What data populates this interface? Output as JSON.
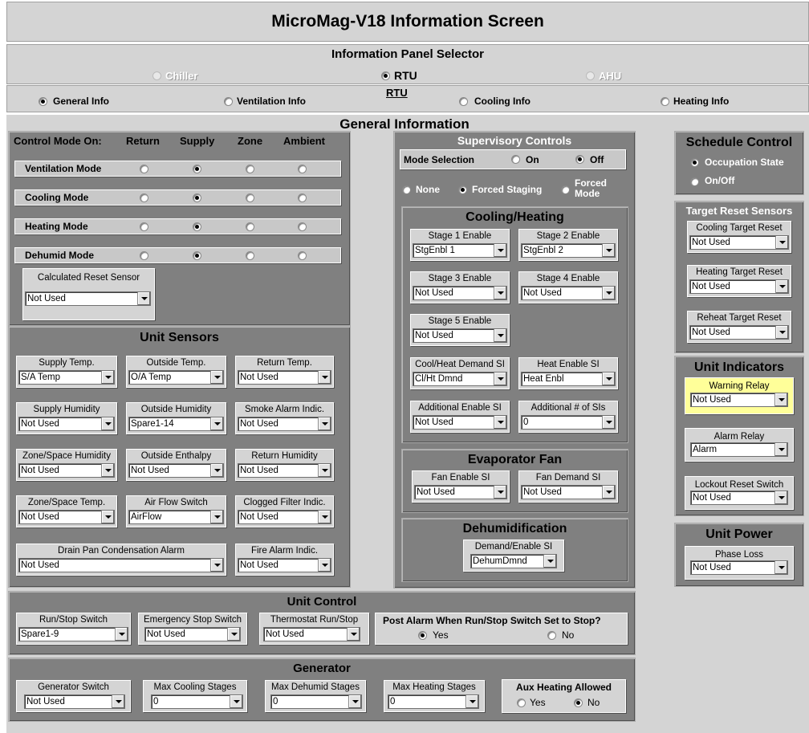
{
  "title": "MicroMag-V18 Information Screen",
  "selector": {
    "heading": "Information Panel Selector",
    "units": [
      {
        "label": "Chiller",
        "selected": false,
        "enabled": false
      },
      {
        "label": "RTU",
        "selected": true,
        "enabled": true
      },
      {
        "label": "AHU",
        "selected": false,
        "enabled": false
      }
    ],
    "active_unit_caption": "RTU",
    "tabs": [
      {
        "label": "General Info",
        "selected": true
      },
      {
        "label": "Ventilation Info",
        "selected": false
      },
      {
        "label": "Cooling Info",
        "selected": false
      },
      {
        "label": "Heating Info",
        "selected": false
      }
    ]
  },
  "section_title": "General Information",
  "control_mode": {
    "heading": "Control Mode On:",
    "columns": [
      "Return",
      "Supply",
      "Zone",
      "Ambient"
    ],
    "rows": [
      {
        "label": "Ventilation Mode",
        "selected": 1
      },
      {
        "label": "Cooling Mode",
        "selected": 1
      },
      {
        "label": "Heating Mode",
        "selected": 1
      },
      {
        "label": "Dehumid Mode",
        "selected": 1
      }
    ],
    "calc_reset": {
      "label": "Calculated Reset Sensor",
      "value": "Not Used"
    }
  },
  "unit_sensors": {
    "title": "Unit Sensors",
    "fields": [
      {
        "label": "Supply Temp.",
        "value": "S/A Temp"
      },
      {
        "label": "Outside Temp.",
        "value": "O/A Temp"
      },
      {
        "label": "Return Temp.",
        "value": "Not Used"
      },
      {
        "label": "Supply Humidity",
        "value": "Not Used"
      },
      {
        "label": "Outside Humidity",
        "value": "Spare1-14"
      },
      {
        "label": "Smoke Alarm Indic.",
        "value": "Not Used"
      },
      {
        "label": "Zone/Space Humidity",
        "value": "Not Used"
      },
      {
        "label": "Outside Enthalpy",
        "value": "Not Used"
      },
      {
        "label": "Return Humidity",
        "value": "Not Used"
      },
      {
        "label": "Zone/Space Temp.",
        "value": "Not Used"
      },
      {
        "label": "Air Flow Switch",
        "value": "AirFlow"
      },
      {
        "label": "Clogged Filter Indic.",
        "value": "Not Used"
      },
      {
        "label": "Drain Pan Condensation Alarm",
        "value": "Not Used"
      },
      {
        "label": "Fire Alarm Indic.",
        "value": "Not Used"
      }
    ]
  },
  "supervisory": {
    "title": "Supervisory Controls",
    "mode_label": "Mode Selection",
    "on_label": "On",
    "off_label": "Off",
    "mode_selected": "Off",
    "none_label": "None",
    "forced_staging_label": "Forced Staging",
    "forced_mode_label": "Forced Mode",
    "force_selected": "Forced Staging"
  },
  "cooling_heating": {
    "title": "Cooling/Heating",
    "fields": [
      {
        "label": "Stage 1 Enable",
        "value": "StgEnbl 1"
      },
      {
        "label": "Stage 2 Enable",
        "value": "StgEnbl 2"
      },
      {
        "label": "Stage 3 Enable",
        "value": "Not Used"
      },
      {
        "label": "Stage 4 Enable",
        "value": "Not Used"
      },
      {
        "label": "Stage 5 Enable",
        "value": "Not Used"
      },
      {
        "label": "Cool/Heat Demand SI",
        "value": "Cl/Ht Dmnd"
      },
      {
        "label": "Heat Enable SI",
        "value": "Heat Enbl"
      },
      {
        "label": "Additional Enable SI",
        "value": "Not Used"
      },
      {
        "label": "Additional # of SIs",
        "value": "0"
      }
    ]
  },
  "evap_fan": {
    "title": "Evaporator Fan",
    "fields": [
      {
        "label": "Fan Enable SI",
        "value": "Not Used"
      },
      {
        "label": "Fan Demand SI",
        "value": "Not Used"
      }
    ]
  },
  "dehumid": {
    "title": "Dehumidification",
    "field": {
      "label": "Demand/Enable SI",
      "value": "DehumDmnd"
    }
  },
  "schedule": {
    "title": "Schedule Control",
    "options": [
      "Occupation State",
      "On/Off"
    ],
    "selected": 0
  },
  "target_reset": {
    "title": "Target Reset Sensors",
    "fields": [
      {
        "label": "Cooling Target Reset",
        "value": "Not Used"
      },
      {
        "label": "Heating Target Reset",
        "value": "Not Used"
      },
      {
        "label": "Reheat Target Reset",
        "value": "Not Used"
      }
    ]
  },
  "indicators": {
    "title": "Unit Indicators",
    "fields": [
      {
        "label": "Warning Relay",
        "value": "Not Used"
      },
      {
        "label": "Alarm Relay",
        "value": "Alarm"
      },
      {
        "label": "Lockout Reset Switch",
        "value": "Not Used"
      }
    ]
  },
  "power": {
    "title": "Unit Power",
    "field": {
      "label": "Phase Loss",
      "value": "Not Used"
    }
  },
  "unit_control": {
    "title": "Unit Control",
    "fields": [
      {
        "label": "Run/Stop Switch",
        "value": "Spare1-9"
      },
      {
        "label": "Emergency Stop Switch",
        "value": "Not Used"
      },
      {
        "label": "Thermostat Run/Stop",
        "value": "Not Used"
      }
    ],
    "post_alarm_question": "Post Alarm When Run/Stop Switch Set to Stop?",
    "yes_label": "Yes",
    "no_label": "No",
    "post_alarm_selected": "Yes"
  },
  "generator": {
    "title": "Generator",
    "fields": [
      {
        "label": "Generator Switch",
        "value": "Not Used"
      },
      {
        "label": "Max Cooling Stages",
        "value": "0"
      },
      {
        "label": "Max Dehumid Stages",
        "value": "0"
      },
      {
        "label": "Max Heating Stages",
        "value": "0"
      }
    ],
    "aux_label": "Aux Heating Allowed",
    "yes_label": "Yes",
    "no_label": "No",
    "aux_selected": "No"
  },
  "colors": {
    "panel": "#808080",
    "group": "#d4d4d4",
    "warning_highlight": "#ffff99"
  }
}
